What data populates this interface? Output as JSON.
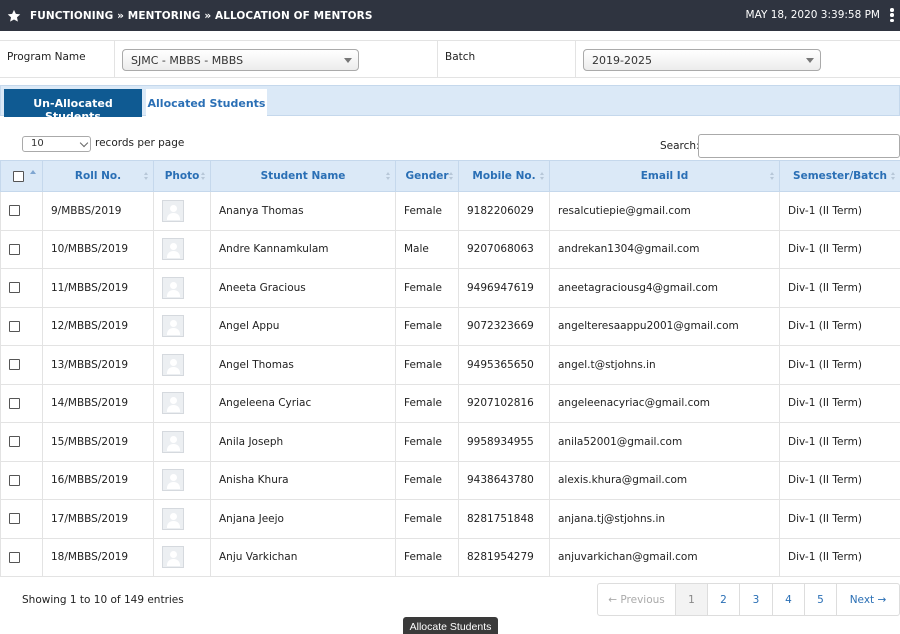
{
  "header": {
    "breadcrumb": "FUNCTIONING » MENTORING » ALLOCATION OF MENTORS",
    "datetime": "MAY 18, 2020  3:39:58 PM"
  },
  "filters": {
    "program_label": "Program Name",
    "program_value": "SJMC - MBBS - MBBS",
    "batch_label": "Batch",
    "batch_value": "2019-2025"
  },
  "tabs": {
    "unallocated": "Un-Allocated Students",
    "allocated": "Allocated Students"
  },
  "controls": {
    "page_length": "10",
    "records_per_page": "records per page",
    "search_label": "Search:"
  },
  "table": {
    "columns": [
      "Roll No.",
      "Photo",
      "Student Name",
      "Gender",
      "Mobile No.",
      "Email Id",
      "Semester/Batch"
    ],
    "rows": [
      {
        "roll": "9/MBBS/2019",
        "name": "Ananya Thomas",
        "gender": "Female",
        "mobile": "9182206029",
        "email": "resalcutiepie@gmail.com",
        "batch": "Div-1 (II Term)"
      },
      {
        "roll": "10/MBBS/2019",
        "name": "Andre Kannamkulam",
        "gender": "Male",
        "mobile": "9207068063",
        "email": "andrekan1304@gmail.com",
        "batch": "Div-1 (II Term)"
      },
      {
        "roll": "11/MBBS/2019",
        "name": "Aneeta Gracious",
        "gender": "Female",
        "mobile": "9496947619",
        "email": "aneetagraciousg4@gmail.com",
        "batch": "Div-1 (II Term)"
      },
      {
        "roll": "12/MBBS/2019",
        "name": "Angel Appu",
        "gender": "Female",
        "mobile": "9072323669",
        "email": "angelteresaappu2001@gmail.com",
        "batch": "Div-1 (II Term)"
      },
      {
        "roll": "13/MBBS/2019",
        "name": "Angel Thomas",
        "gender": "Female",
        "mobile": "9495365650",
        "email": "angel.t@stjohns.in",
        "batch": "Div-1 (II Term)"
      },
      {
        "roll": "14/MBBS/2019",
        "name": "Angeleena Cyriac",
        "gender": "Female",
        "mobile": "9207102816",
        "email": "angeleenacyriac@gmail.com",
        "batch": "Div-1 (II Term)"
      },
      {
        "roll": "15/MBBS/2019",
        "name": "Anila Joseph",
        "gender": "Female",
        "mobile": "9958934955",
        "email": "anila52001@gmail.com",
        "batch": "Div-1 (II Term)"
      },
      {
        "roll": "16/MBBS/2019",
        "name": "Anisha Khura",
        "gender": "Female",
        "mobile": "9438643780",
        "email": "alexis.khura@gmail.com",
        "batch": "Div-1 (II Term)"
      },
      {
        "roll": "17/MBBS/2019",
        "name": "Anjana Jeejo",
        "gender": "Female",
        "mobile": "8281751848",
        "email": "anjana.tj@stjohns.in",
        "batch": "Div-1 (II Term)"
      },
      {
        "roll": "18/MBBS/2019",
        "name": "Anju Varkichan",
        "gender": "Female",
        "mobile": "8281954279",
        "email": "anjuvarkichan@gmail.com",
        "batch": "Div-1 (II Term)"
      }
    ]
  },
  "footer": {
    "info": "Showing 1 to 10 of 149 entries",
    "previous": "← Previous",
    "pages": [
      "1",
      "2",
      "3",
      "4",
      "5"
    ],
    "next": "Next →",
    "allocate": "Allocate Students"
  },
  "icons": {
    "header": "star-icon",
    "menu": "kebab-menu-icon",
    "photo": "user-placeholder-icon"
  }
}
